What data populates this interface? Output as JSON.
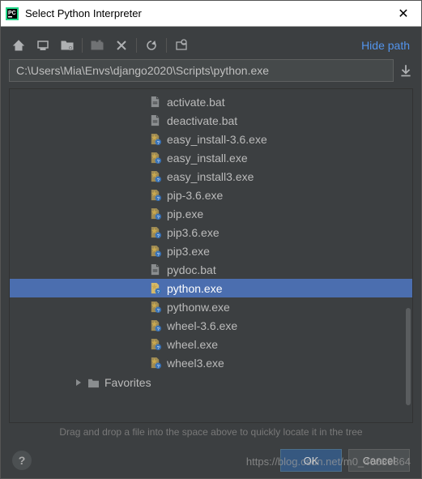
{
  "window": {
    "title": "Select Python Interpreter"
  },
  "toolbar": {
    "hide_path": "Hide path"
  },
  "path_input": "C:\\Users\\Mia\\Envs\\django2020\\Scripts\\python.exe",
  "files": [
    {
      "name": "activate.bat",
      "type": "bat",
      "selected": false
    },
    {
      "name": "deactivate.bat",
      "type": "bat",
      "selected": false
    },
    {
      "name": "easy_install-3.6.exe",
      "type": "exe",
      "selected": false
    },
    {
      "name": "easy_install.exe",
      "type": "exe",
      "selected": false
    },
    {
      "name": "easy_install3.exe",
      "type": "exe",
      "selected": false
    },
    {
      "name": "pip-3.6.exe",
      "type": "exe",
      "selected": false
    },
    {
      "name": "pip.exe",
      "type": "exe",
      "selected": false
    },
    {
      "name": "pip3.6.exe",
      "type": "exe",
      "selected": false
    },
    {
      "name": "pip3.exe",
      "type": "exe",
      "selected": false
    },
    {
      "name": "pydoc.bat",
      "type": "bat",
      "selected": false
    },
    {
      "name": "python.exe",
      "type": "exe",
      "selected": true
    },
    {
      "name": "pythonw.exe",
      "type": "exe",
      "selected": false
    },
    {
      "name": "wheel-3.6.exe",
      "type": "exe",
      "selected": false
    },
    {
      "name": "wheel.exe",
      "type": "exe",
      "selected": false
    },
    {
      "name": "wheel3.exe",
      "type": "exe",
      "selected": false
    }
  ],
  "favorites_label": "Favorites",
  "help_text": "Drag and drop a file into the space above to quickly locate it in the tree",
  "buttons": {
    "ok": "OK",
    "cancel": "Cancel",
    "help": "?"
  },
  "watermark": "https://blog.csdn.net/m0_46639364"
}
